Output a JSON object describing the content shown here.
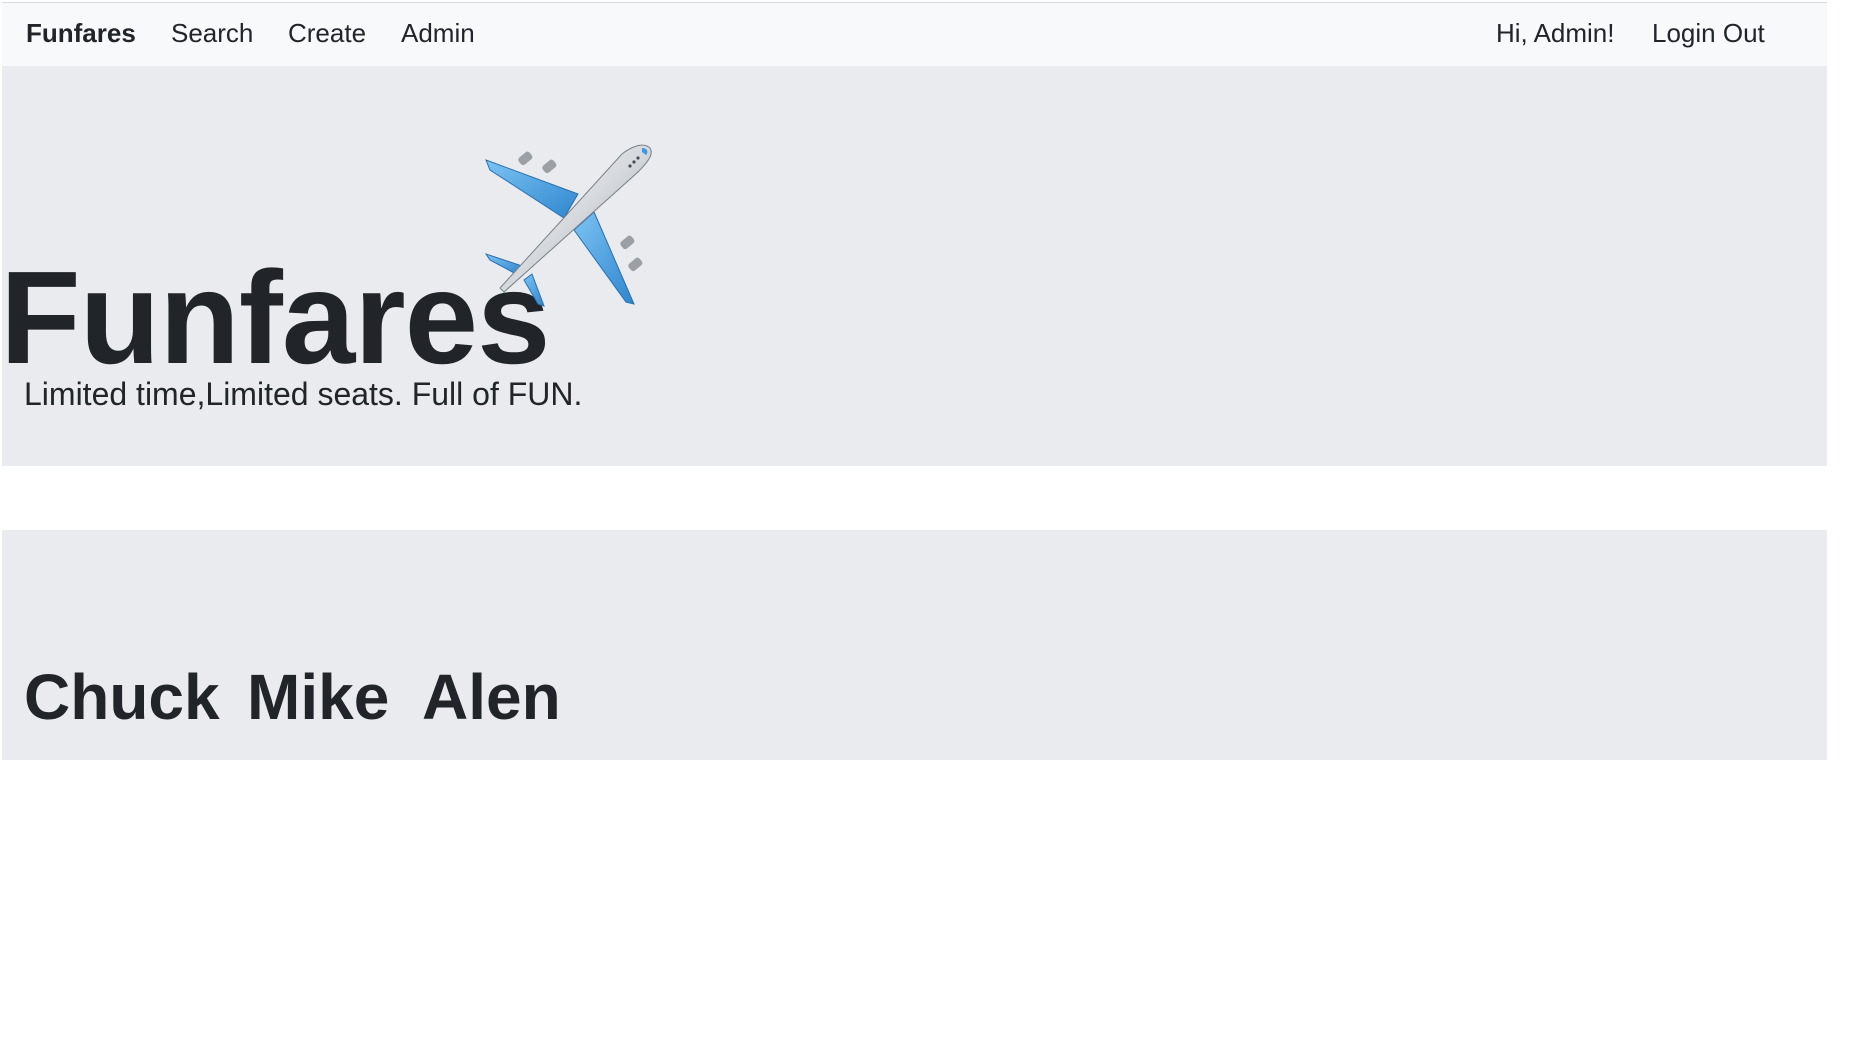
{
  "navbar": {
    "brand": "Funfares",
    "links": [
      "Search",
      "Create",
      "Admin"
    ],
    "greeting": "Hi, Admin!",
    "logout": "Login Out"
  },
  "hero": {
    "title": "Funfares",
    "icon": "airplane-icon",
    "tagline": "Limited time,Limited seats. Full of FUN."
  },
  "members": {
    "names": [
      "Chuck",
      "Mike",
      "Alen"
    ]
  },
  "colors": {
    "navbar_bg": "#f8f9fa",
    "panel_bg": "#e9ebee",
    "text": "#212529",
    "plane_wing": "#3b9ae1"
  }
}
